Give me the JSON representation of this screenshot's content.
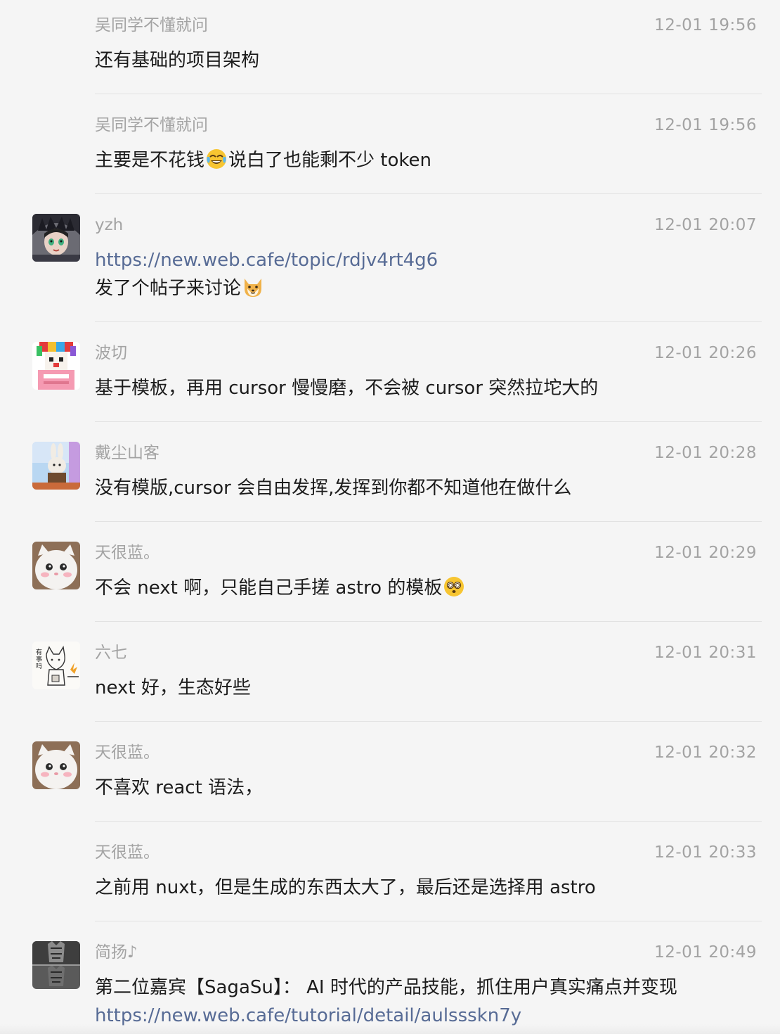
{
  "messages": [
    {
      "sender": "吴同学不懂就问",
      "time": "12-01 19:56",
      "avatar": "",
      "lines": [
        "还有基础的项目架构"
      ]
    },
    {
      "sender": "吴同学不懂就问",
      "time": "12-01 19:56",
      "avatar": "",
      "lines": [
        "主要是不花钱",
        "说白了也能剩不少 token"
      ],
      "emoji": "tears-of-joy-emoji"
    },
    {
      "sender": "yzh",
      "time": "12-01 20:07",
      "avatar": "dark-costume-avatar",
      "link": "https://new.web.cafe/topic/rdjv4rt4g6",
      "lines": [
        "发了个帖子来讨论"
      ],
      "emoji": "shiba-dog-emoji"
    },
    {
      "sender": "波切",
      "time": "12-01 20:26",
      "avatar": "pixel-clown-avatar",
      "lines": [
        "基于模板，再用 cursor 慢慢磨，不会被 cursor 突然拉坨大的"
      ]
    },
    {
      "sender": "戴尘山客",
      "time": "12-01 20:28",
      "avatar": "rabbit-cartoon-avatar",
      "lines": [
        "没有模版,cursor 会自由发挥,发挥到你都不知道他在做什么"
      ]
    },
    {
      "sender": "天很蓝。",
      "time": "12-01 20:29",
      "avatar": "white-cat-avatar",
      "lines": [
        "不会 next 啊，只能自己手搓 astro 的模板"
      ],
      "emoji": "dizzy-face-emoji"
    },
    {
      "sender": "六七",
      "time": "12-01 20:31",
      "avatar": "sketch-fox-avatar",
      "lines": [
        "next 好，生态好些"
      ]
    },
    {
      "sender": "天很蓝。",
      "time": "12-01 20:32",
      "avatar": "white-cat-avatar",
      "lines": [
        "不喜欢 react 语法，"
      ]
    },
    {
      "sender": "天很蓝。",
      "time": "12-01 20:33",
      "avatar": "",
      "lines": [
        "之前用 nuxt，但是生成的东西太大了，最后还是选择用 astro"
      ]
    },
    {
      "sender": "简扬♪",
      "time": "12-01 20:49",
      "avatar": "tiger-reflection-avatar",
      "lines": [
        "第二位嘉宾【SagaSu】： AI 时代的产品技能，抓住用户真实痛点并变现"
      ],
      "link_after": "https://new.web.cafe/tutorial/detail/aulssskn7y"
    }
  ],
  "colors": {
    "background": "#f5f5f5",
    "meta_text": "#a3a3a3",
    "body_text": "#1c1c1c",
    "link": "#576b95",
    "divider": "#e2e2e2"
  }
}
